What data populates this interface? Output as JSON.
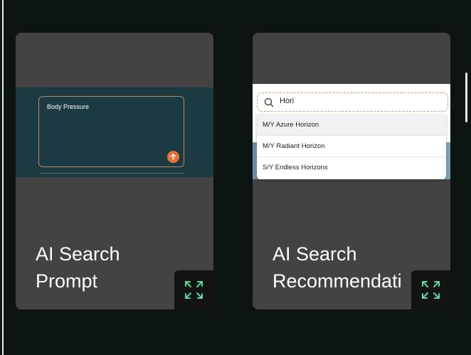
{
  "cards": [
    {
      "title_line1": "AI Search",
      "title_line2": "Prompt",
      "preview": {
        "prompt_label": "Body Pressure",
        "submit_icon": "arrow-up-icon"
      },
      "expand_icon": "expand-icon"
    },
    {
      "title_line1": "AI Search",
      "title_line2": "Recommendati",
      "preview": {
        "search_value": "Hori",
        "search_icon": "search-icon",
        "suggestions": [
          "M/Y Azure Horizon",
          "M/Y Radiant Horizon",
          "S/Y Endless Horizons"
        ]
      },
      "expand_icon": "expand-icon"
    }
  ],
  "colors": {
    "page_bg": "#0d1512",
    "card_bg": "#434343",
    "preview_teal": "#1b3a41",
    "submit_orange": "#e8713b",
    "expand_green": "#5fd7a1"
  }
}
